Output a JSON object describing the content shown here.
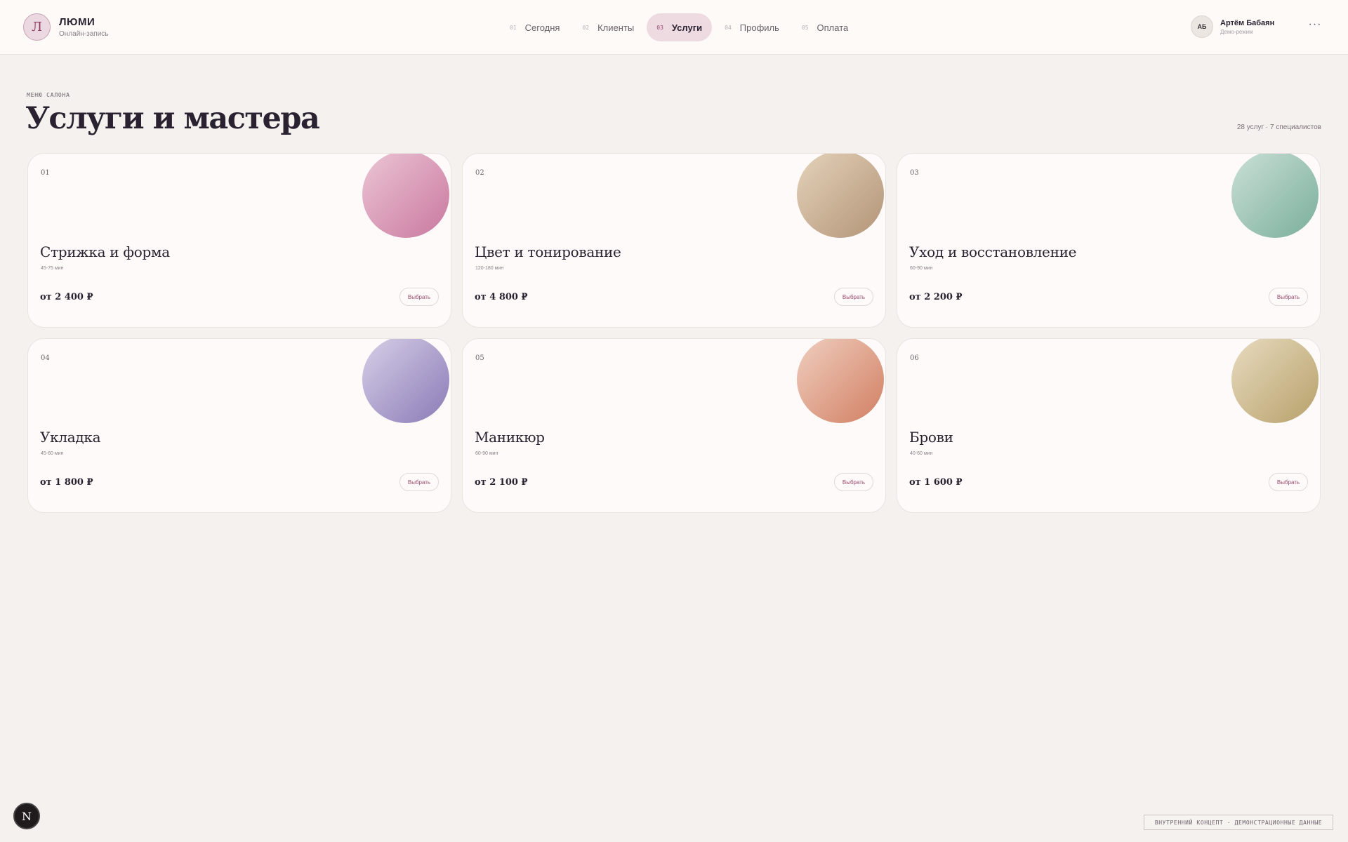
{
  "brand": {
    "logo_letter": "Л",
    "name": "ЛЮМИ",
    "subtitle": "Онлайн-запись"
  },
  "nav": [
    {
      "num": "01",
      "label": "Сегодня",
      "active": false
    },
    {
      "num": "02",
      "label": "Клиенты",
      "active": false
    },
    {
      "num": "03",
      "label": "Услуги",
      "active": true
    },
    {
      "num": "04",
      "label": "Профиль",
      "active": false
    },
    {
      "num": "05",
      "label": "Оплата",
      "active": false
    }
  ],
  "user": {
    "initials": "АБ",
    "name": "Артём Бабаян",
    "mode": "Демо-режим",
    "menu_glyph": "···"
  },
  "page": {
    "eyebrow": "МЕНЮ САЛОНА",
    "title": "Услуги и мастера",
    "meta": "28 услуг · 7 специалистов"
  },
  "cards": [
    {
      "num": "01",
      "title": "Стрижка и форма",
      "duration": "45-75 мин",
      "price": "от 2 400 ₽",
      "button": "Выбрать",
      "colors": [
        "#ecc6d6",
        "#c9789e"
      ]
    },
    {
      "num": "02",
      "title": "Цвет и тонирование",
      "duration": "120-180 мин",
      "price": "от 4 800 ₽",
      "button": "Выбрать",
      "colors": [
        "#e4d3ba",
        "#b39478"
      ]
    },
    {
      "num": "03",
      "title": "Уход и восстановление",
      "duration": "60-90 мин",
      "price": "от 2 200 ₽",
      "button": "Выбрать",
      "colors": [
        "#cbe0d6",
        "#7aaf9a"
      ]
    },
    {
      "num": "04",
      "title": "Укладка",
      "duration": "45-60 мин",
      "price": "от 1 800 ₽",
      "button": "Выбрать",
      "colors": [
        "#d8d0e8",
        "#8a7ab6"
      ]
    },
    {
      "num": "05",
      "title": "Маникюр",
      "duration": "60-90 мин",
      "price": "от 2 100 ₽",
      "button": "Выбрать",
      "colors": [
        "#f0cfc0",
        "#d17f62"
      ]
    },
    {
      "num": "06",
      "title": "Брови",
      "duration": "40-60 мин",
      "price": "от 1 600 ₽",
      "button": "Выбрать",
      "colors": [
        "#e8dcc0",
        "#b7a06a"
      ]
    }
  ],
  "fab": {
    "letter": "N"
  },
  "footer_note": "ВНУТРЕННИЙ КОНЦЕПТ · ДЕМОНСТРАЦИОННЫЕ ДАННЫЕ"
}
